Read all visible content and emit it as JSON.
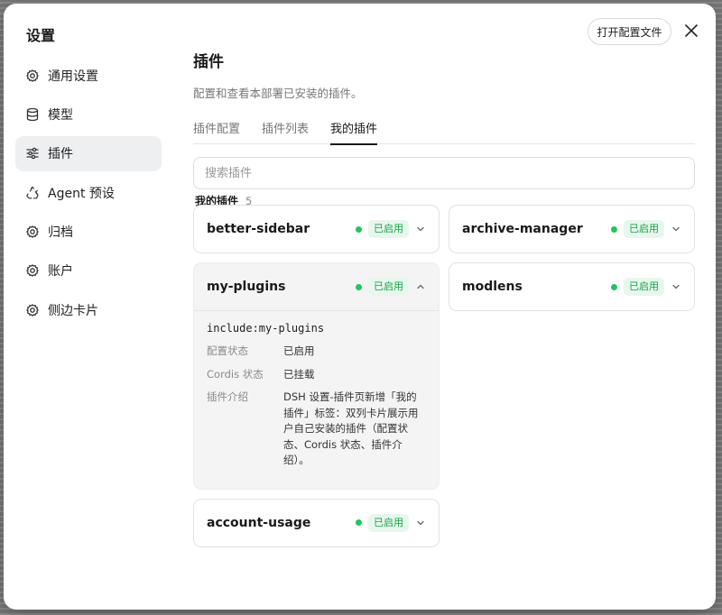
{
  "dialog": {
    "title": "设置",
    "open_config_label": "打开配置文件",
    "close_icon": "close-icon"
  },
  "sidebar": {
    "items": [
      {
        "label": "通用设置",
        "icon": "gear-icon",
        "active": false
      },
      {
        "label": "模型",
        "icon": "database-icon",
        "active": false
      },
      {
        "label": "插件",
        "icon": "sliders-icon",
        "active": true
      },
      {
        "label": "Agent 预设",
        "icon": "recycle-icon",
        "active": false
      },
      {
        "label": "归档",
        "icon": "gear-icon",
        "active": false
      },
      {
        "label": "账户",
        "icon": "gear-icon",
        "active": false
      },
      {
        "label": "侧边卡片",
        "icon": "gear-icon",
        "active": false
      }
    ]
  },
  "main": {
    "title": "插件",
    "description": "配置和查看本部署已安装的插件。",
    "tabs": [
      {
        "label": "插件配置",
        "active": false
      },
      {
        "label": "插件列表",
        "active": false
      },
      {
        "label": "我的插件",
        "active": true
      }
    ],
    "search": {
      "placeholder": "搜索插件",
      "value": ""
    },
    "section": {
      "title": "我的插件",
      "count": "5"
    }
  },
  "plugins": [
    {
      "name": "better-sidebar",
      "status": "已启用",
      "expanded": false
    },
    {
      "name": "archive-manager",
      "status": "已启用",
      "expanded": false
    },
    {
      "name": "my-plugins",
      "status": "已启用",
      "expanded": true,
      "include": "include:my-plugins",
      "details": [
        {
          "key": "配置状态",
          "value": "已启用"
        },
        {
          "key": "Cordis 状态",
          "value": "已挂载"
        },
        {
          "key": "插件介绍",
          "value": "DSH 设置-插件页新增「我的插件」标签：双列卡片展示用户自己安装的插件（配置状态、Cordis 状态、插件介绍）。"
        }
      ]
    },
    {
      "name": "modlens",
      "status": "已启用",
      "expanded": false
    },
    {
      "name": "account-usage",
      "status": "已启用",
      "expanded": false
    }
  ],
  "colors": {
    "accent_green": "#22c55e",
    "badge_bg": "#e8f7ed",
    "active_bg": "#eeeff1"
  }
}
